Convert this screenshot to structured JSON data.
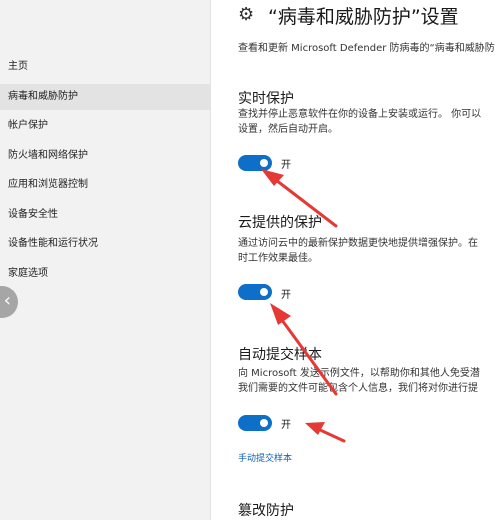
{
  "sidebar": {
    "items": [
      {
        "label": "主页"
      },
      {
        "label": "病毒和威胁防护"
      },
      {
        "label": "帐户保护"
      },
      {
        "label": "防火墙和网络保护"
      },
      {
        "label": "应用和浏览器控制"
      },
      {
        "label": "设备安全性"
      },
      {
        "label": "设备性能和运行状况"
      },
      {
        "label": "家庭选项"
      }
    ],
    "back_icon": "chevron-left-icon"
  },
  "header": {
    "title": "“病毒和威胁防护”设置",
    "description": "查看和更新 Microsoft Defender 防病毒的“病毒和威胁防",
    "icon": "gear-icon"
  },
  "sections": [
    {
      "title": "实时保护",
      "desc1": "查找并停止恶意软件在你的设备上安装或运行。 你可以",
      "desc2": "设置，然后自动开启。",
      "toggle_label": "开"
    },
    {
      "title": "云提供的保护",
      "desc1": "通过访问云中的最新保护数据更快地提供增强保护。在",
      "desc2": "时工作效果最佳。",
      "toggle_label": "开"
    },
    {
      "title": "自动提交样本",
      "desc1": "向 Microsoft 发送示例文件，以帮助你和其他人免受潜",
      "desc2": "我们需要的文件可能包含个人信息，我们将对你进行提",
      "toggle_label": "开",
      "link": "手动提交样本"
    },
    {
      "title": "篡改防护"
    }
  ],
  "colors": {
    "accent": "#0e6fc9",
    "arrow": "#e53935"
  }
}
